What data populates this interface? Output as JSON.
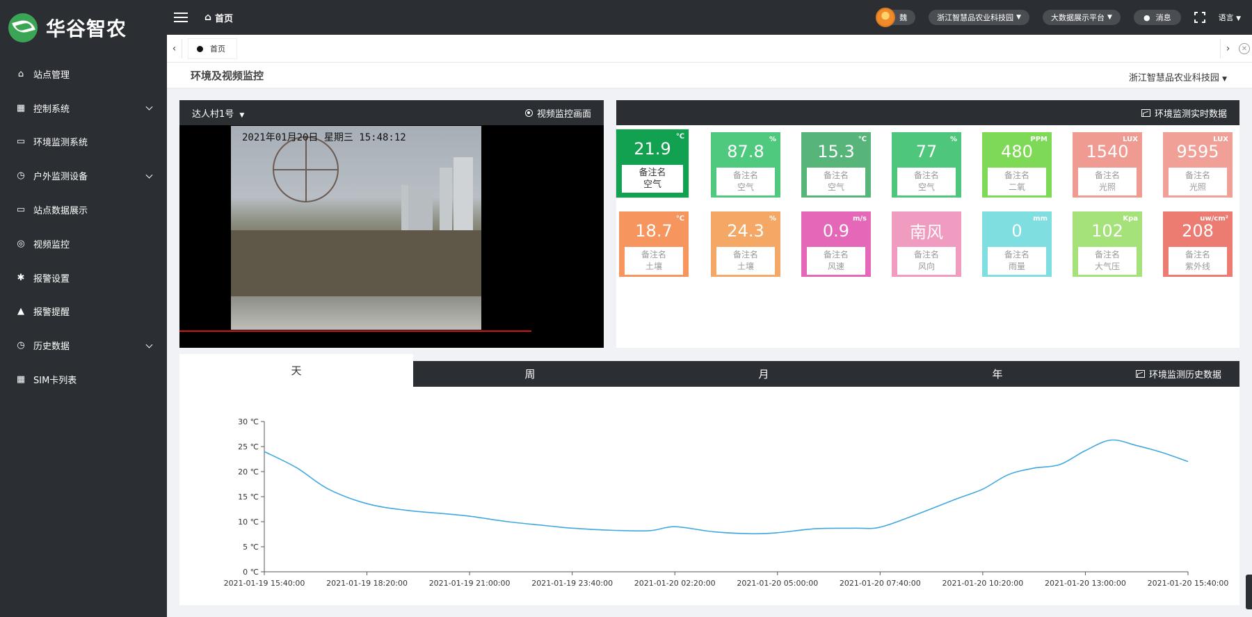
{
  "brand": {
    "name": "华谷智农",
    "color": "#3aa655"
  },
  "sidebar": {
    "items": [
      {
        "label": "站点管理",
        "icon": "home-icon",
        "glyph": "⌂",
        "expandable": false
      },
      {
        "label": "控制系统",
        "icon": "grid-icon",
        "glyph": "▦",
        "expandable": true
      },
      {
        "label": "环境监测系统",
        "icon": "monitor-chart-icon",
        "glyph": "▭",
        "expandable": false
      },
      {
        "label": "户外监测设备",
        "icon": "history-icon",
        "glyph": "◷",
        "expandable": true
      },
      {
        "label": "站点数据展示",
        "icon": "display-icon",
        "glyph": "▭",
        "expandable": false
      },
      {
        "label": "视频监控",
        "icon": "camera-icon",
        "glyph": "◎",
        "expandable": false
      },
      {
        "label": "报警设置",
        "icon": "bug-icon",
        "glyph": "✱",
        "expandable": false
      },
      {
        "label": "报警提醒",
        "icon": "warning-icon",
        "glyph": "▲",
        "expandable": false
      },
      {
        "label": "历史数据",
        "icon": "history-icon",
        "glyph": "◷",
        "expandable": true
      },
      {
        "label": "SIM卡列表",
        "icon": "grid-icon",
        "glyph": "▦",
        "expandable": false
      }
    ]
  },
  "topbar": {
    "home": "首页",
    "user": "魏",
    "org": "浙江智慧品农业科技园",
    "platform": "大数据展示平台",
    "messages": "消息",
    "language": "语言"
  },
  "tabs": {
    "current": "首页"
  },
  "content": {
    "title": "环境及视频监控",
    "org_select": "浙江智慧品农业科技园"
  },
  "video": {
    "camera_select": "达人村1号",
    "panel_title": "视频监控画面",
    "osd": "2021年01月20日  星期三  15:48:12"
  },
  "env": {
    "panel_title": "环境监测实时数据",
    "note_label": "备注名",
    "cards": [
      {
        "value": "21.9",
        "unit": "℃",
        "type": "空气",
        "color": "#12a150",
        "active": true
      },
      {
        "value": "87.8",
        "unit": "%",
        "type": "空气",
        "color": "#4fc97e"
      },
      {
        "value": "15.3",
        "unit": "℃",
        "type": "空气",
        "color": "#57b57a"
      },
      {
        "value": "77",
        "unit": "%",
        "type": "空气",
        "color": "#4ec77d"
      },
      {
        "value": "480",
        "unit": "PPM",
        "type": "二氧",
        "color": "#7ed957"
      },
      {
        "value": "1540",
        "unit": "LUX",
        "type": "光照",
        "color": "#ef9b92"
      },
      {
        "value": "9595",
        "unit": "LUX",
        "type": "光照",
        "color": "#f0a097"
      },
      {
        "value": "18.7",
        "unit": "℃",
        "type": "土壤",
        "color": "#f6955e"
      },
      {
        "value": "24.3",
        "unit": "%",
        "type": "土壤",
        "color": "#f5a866"
      },
      {
        "value": "0.9",
        "unit": "m/s",
        "type": "风速",
        "color": "#e568b8"
      },
      {
        "value": "南风",
        "unit": "",
        "type": "风向",
        "color": "#f09bc0"
      },
      {
        "value": "0",
        "unit": "mm",
        "type": "雨量",
        "color": "#7fdedf"
      },
      {
        "value": "102",
        "unit": "Kpa",
        "type": "大气压",
        "color": "#a5e27a"
      },
      {
        "value": "208",
        "unit": "uw/cm²",
        "type": "紫外线",
        "color": "#ec7c72"
      }
    ]
  },
  "history": {
    "tabs": [
      "天",
      "周",
      "月",
      "年"
    ],
    "active_tab": "天",
    "title": "环境监测历史数据"
  },
  "chart_data": {
    "type": "line",
    "ylim": [
      0,
      30
    ],
    "yticks": [
      0,
      5,
      10,
      15,
      20,
      25,
      30
    ],
    "yunit": "℃",
    "xtick_labels": [
      "2021-01-19 15:40:00",
      "2021-01-19 18:20:00",
      "2021-01-19 21:00:00",
      "2021-01-19 23:40:00",
      "2021-01-20 02:20:00",
      "2021-01-20 05:00:00",
      "2021-01-20 07:40:00",
      "2021-01-20 10:20:00",
      "2021-01-20 13:00:00",
      "2021-01-20 15:40:00"
    ],
    "line_color": "#3fa8e0",
    "series": [
      {
        "x": [
          "2021-01-19 15:40",
          "2021-01-19 16:30",
          "2021-01-19 17:20",
          "2021-01-19 18:20",
          "2021-01-19 19:20",
          "2021-01-19 20:20",
          "2021-01-19 21:00",
          "2021-01-19 22:00",
          "2021-01-19 23:00",
          "2021-01-19 23:40",
          "2021-01-20 00:40",
          "2021-01-20 01:40",
          "2021-01-20 02:20",
          "2021-01-20 03:20",
          "2021-01-20 04:20",
          "2021-01-20 05:00",
          "2021-01-20 06:00",
          "2021-01-20 07:00",
          "2021-01-20 07:40",
          "2021-01-20 08:40",
          "2021-01-20 09:40",
          "2021-01-20 10:20",
          "2021-01-20 11:00",
          "2021-01-20 11:40",
          "2021-01-20 12:20",
          "2021-01-20 13:00",
          "2021-01-20 13:40",
          "2021-01-20 14:20",
          "2021-01-20 15:00",
          "2021-01-20 15:40"
        ],
        "values": [
          24.0,
          20.8,
          16.5,
          13.6,
          12.3,
          11.6,
          11.1,
          10.0,
          9.2,
          8.7,
          8.3,
          8.2,
          9.0,
          8.0,
          7.6,
          7.8,
          8.6,
          8.7,
          8.9,
          11.6,
          14.6,
          16.5,
          19.4,
          20.7,
          21.4,
          24.2,
          26.3,
          25.2,
          23.8,
          22.0
        ]
      }
    ]
  }
}
